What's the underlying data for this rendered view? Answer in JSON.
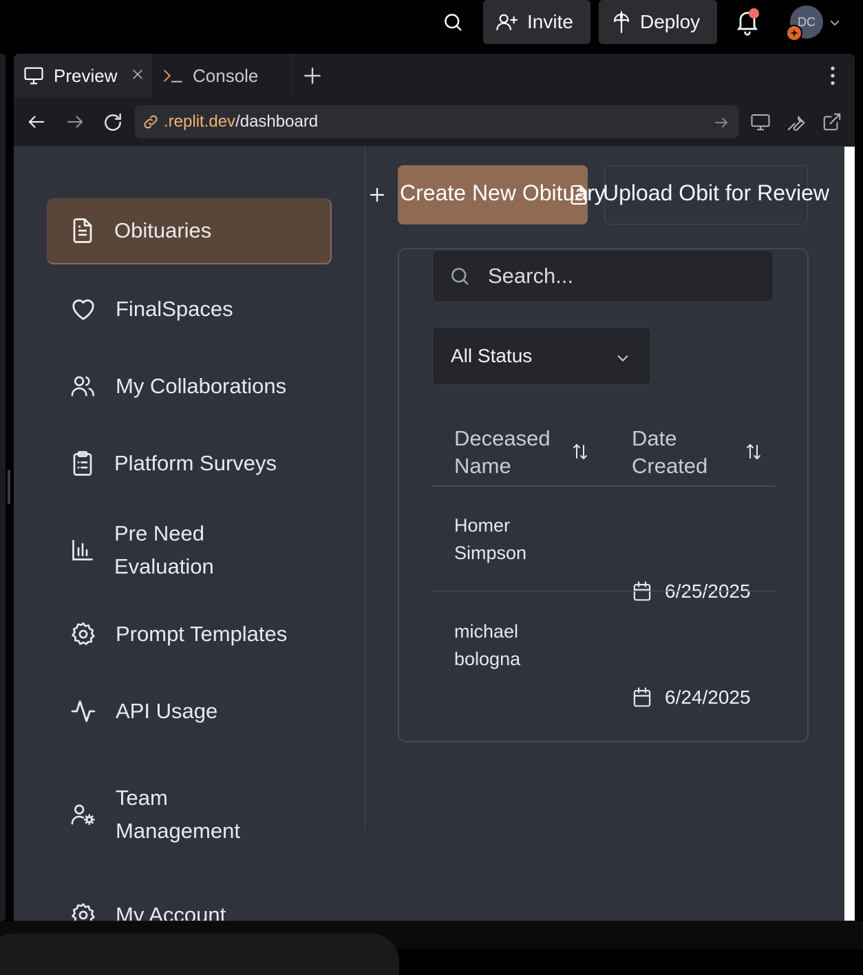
{
  "topbar": {
    "invite_label": "Invite",
    "deploy_label": "Deploy",
    "avatar_initials": "DC"
  },
  "tabs": [
    {
      "label": "Preview",
      "icon": "monitor-icon"
    },
    {
      "label": "Console",
      "icon": "terminal-icon"
    }
  ],
  "url": {
    "host": ".replit.dev",
    "path": "/dashboard"
  },
  "sidebar": {
    "items": [
      {
        "label": "Obituaries",
        "icon": "document-icon",
        "active": true
      },
      {
        "label": "FinalSpaces",
        "icon": "heart-icon"
      },
      {
        "label": "My Collaborations",
        "icon": "users-icon"
      },
      {
        "label": "Platform Surveys",
        "icon": "clipboard-icon"
      },
      {
        "label": "Pre Need\nEvaluation",
        "icon": "bar-chart-icon"
      },
      {
        "label": "Prompt Templates",
        "icon": "gear-icon"
      },
      {
        "label": "API Usage",
        "icon": "activity-icon"
      },
      {
        "label": "Team\nManagement",
        "icon": "user-cog-icon"
      },
      {
        "label": "My Account",
        "icon": "gear-icon"
      }
    ]
  },
  "actions": {
    "create_label": "Create New Obituary",
    "upload_label": "Upload Obit for Review"
  },
  "filters": {
    "search_placeholder": "Search...",
    "status_value": "All Status"
  },
  "table": {
    "headers": [
      "Deceased\nName",
      "Date\nCreated"
    ],
    "rows": [
      {
        "name": "Homer\nSimpson",
        "date": "6/25/2025"
      },
      {
        "name": "michael\nbologna",
        "date": "6/24/2025"
      }
    ]
  },
  "colors": {
    "accent": "#8f6b53",
    "active_nav": "#5a4638",
    "url_host": "#f0b36e",
    "notification_dot": "#f56b6b"
  }
}
